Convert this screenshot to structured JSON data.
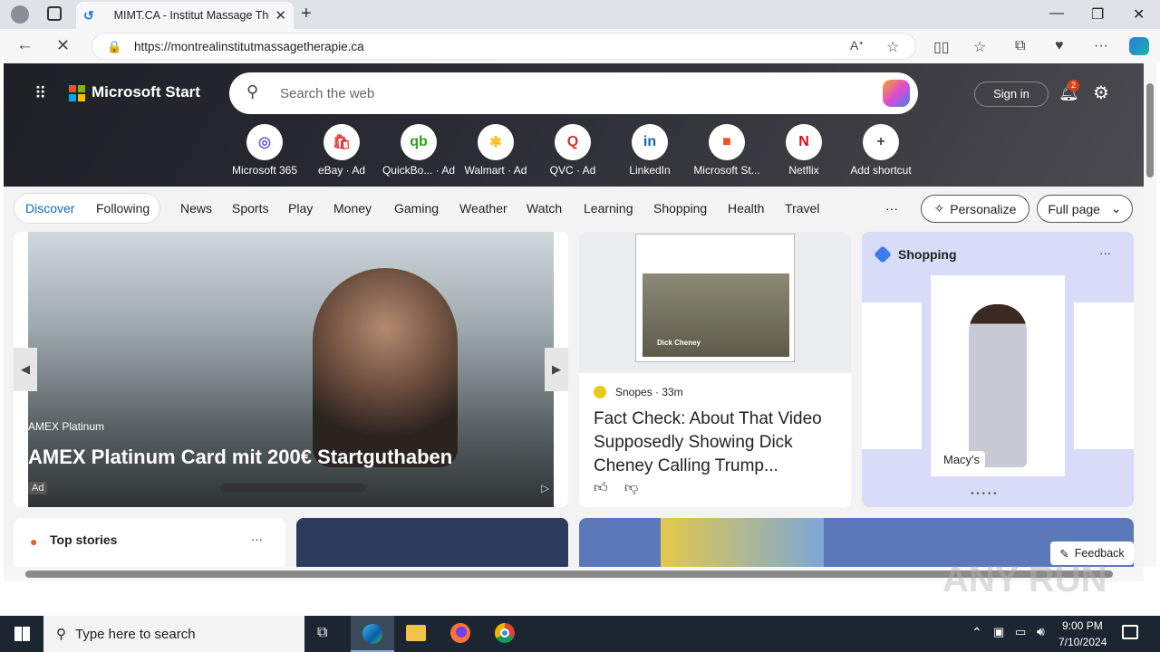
{
  "browser": {
    "tab_title": "MIMT.CA - Institut Massage Thérapie",
    "url": "https://montrealinstitutmassagetherapie.ca"
  },
  "header": {
    "brand": "Microsoft Start",
    "search_placeholder": "Search the web",
    "sign_in": "Sign in",
    "notifications_count": "2"
  },
  "shortcuts": [
    {
      "label": "Microsoft 365",
      "glyph": "◎",
      "color": "#6a5acd"
    },
    {
      "label": "eBay · Ad",
      "glyph": "🛍",
      "color": "#e53238"
    },
    {
      "label": "QuickBo... · Ad",
      "glyph": "qb",
      "color": "#2ca01c"
    },
    {
      "label": "Walmart · Ad",
      "glyph": "✱",
      "color": "#ffc220"
    },
    {
      "label": "QVC · Ad",
      "glyph": "Q",
      "color": "#c33"
    },
    {
      "label": "LinkedIn",
      "glyph": "in",
      "color": "#0a66c2"
    },
    {
      "label": "Microsoft St...",
      "glyph": "■",
      "color": "#f25022"
    },
    {
      "label": "Netflix",
      "glyph": "N",
      "color": "#e50914"
    },
    {
      "label": "Add shortcut",
      "glyph": "+",
      "color": "#444"
    }
  ],
  "nav": {
    "discover": "Discover",
    "following": "Following",
    "items": [
      "News",
      "Sports",
      "Play",
      "Money",
      "Gaming",
      "Weather",
      "Watch",
      "Learning",
      "Shopping",
      "Health",
      "Travel"
    ],
    "more": "···",
    "personalize": "Personalize",
    "full_page": "Full page"
  },
  "carousel": {
    "source": "AMEX Platinum",
    "headline": "AMEX Platinum Card mit 200€ Startguthaben",
    "ad_badge": "Ad"
  },
  "news": {
    "source": "Snopes",
    "time": "· 33m",
    "headline": "Fact Check: About That Video Supposedly Showing Dick Cheney Calling Trump...",
    "tweet_caption": "Dick Cheney"
  },
  "shopping": {
    "title": "Shopping",
    "store": "Macy's",
    "more": "···"
  },
  "top_stories": {
    "title": "Top stories",
    "more": "···"
  },
  "feedback": "Feedback",
  "taskbar": {
    "search_placeholder": "Type here to search",
    "time": "9:00 PM",
    "date": "7/10/2024"
  },
  "watermark": "ANY RUN"
}
